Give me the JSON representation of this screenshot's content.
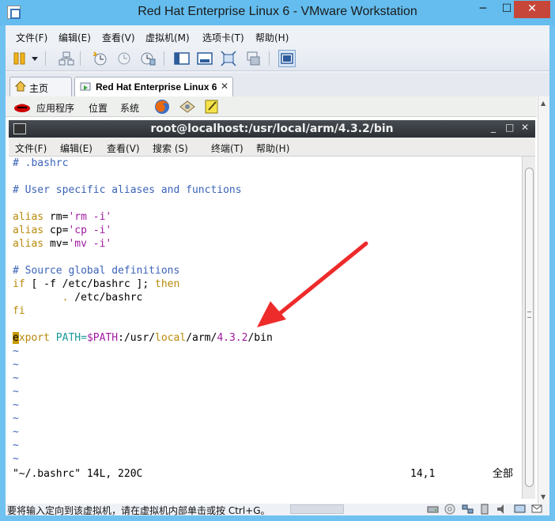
{
  "window": {
    "title": "Red Hat Enterprise Linux 6 - VMware Workstation",
    "min_glyph": "─",
    "max_glyph": "☐",
    "close_glyph": "✕"
  },
  "menubar": [
    "文件(F)",
    "编辑(E)",
    "查看(V)",
    "虚拟机(M)",
    "选项卡(T)",
    "帮助(H)"
  ],
  "toolbar_icons": [
    "pause-icon",
    "dropdown-icon",
    "network-icon",
    "snapshot-icon",
    "revert-snapshot-icon",
    "manage-snapshots-icon",
    "console-view-icon",
    "quick-switch-icon",
    "fullscreen-icon",
    "unity-icon",
    "thumbnail-view-icon"
  ],
  "tabs": {
    "home": "主页",
    "vm": "Red Hat Enterprise Linux 6",
    "close_glyph": "✕"
  },
  "guest_panel": {
    "applications": "应用程序",
    "places": "位置",
    "system": "系统"
  },
  "terminal": {
    "title": "root@localhost:/usr/local/arm/4.3.2/bin",
    "menu": [
      "文件(F)",
      "编辑(E)",
      "查看(V)",
      "搜索 (S)",
      "终端(T)",
      "帮助(H)"
    ],
    "controls": [
      "_",
      "□",
      "✕"
    ]
  },
  "vim": {
    "comment_bashrc": "# .bashrc",
    "comment_aliases": "# User specific aliases and functions",
    "alias_rm": {
      "kw": "alias",
      "name": " rm=",
      "val": "'rm -i'"
    },
    "alias_cp": {
      "kw": "alias",
      "name": " cp=",
      "val": "'cp -i'"
    },
    "alias_mv": {
      "kw": "alias",
      "name": " mv=",
      "val": "'mv -i'"
    },
    "comment_source": "# Source global definitions",
    "if_kw": "if",
    "if_rest": " [ -f /etc/bashrc ]; ",
    "then_kw": "then",
    "source_dot": "        .",
    "source_path": " /etc/bashrc",
    "fi_kw": "fi",
    "export_cursor": "e",
    "export_rest": "xport",
    "path_eq": " PATH=",
    "path_var": "$PATH",
    "path_1": ":/usr/",
    "path_local": "local",
    "path_2": "/arm/",
    "path_ver": "4.3.2",
    "path_3": "/bin",
    "tilde": "~",
    "status_file": "\"~/.bashrc\" 14L, 220C",
    "status_pos": "14,1",
    "status_all": "全部"
  },
  "statusbar": {
    "message": "要将输入定向到该虚拟机，请在虚拟机内部单击或按 Ctrl+G。"
  },
  "colors": {
    "titlebar": "#64bdee",
    "close_button": "#c7463a",
    "vim_comment": "#3b63b8",
    "vim_keyword": "#b8890a",
    "vim_string": "#a01aa0",
    "vim_variable": "#1a9a9a",
    "annotation_arrow": "#ee2b2b"
  }
}
